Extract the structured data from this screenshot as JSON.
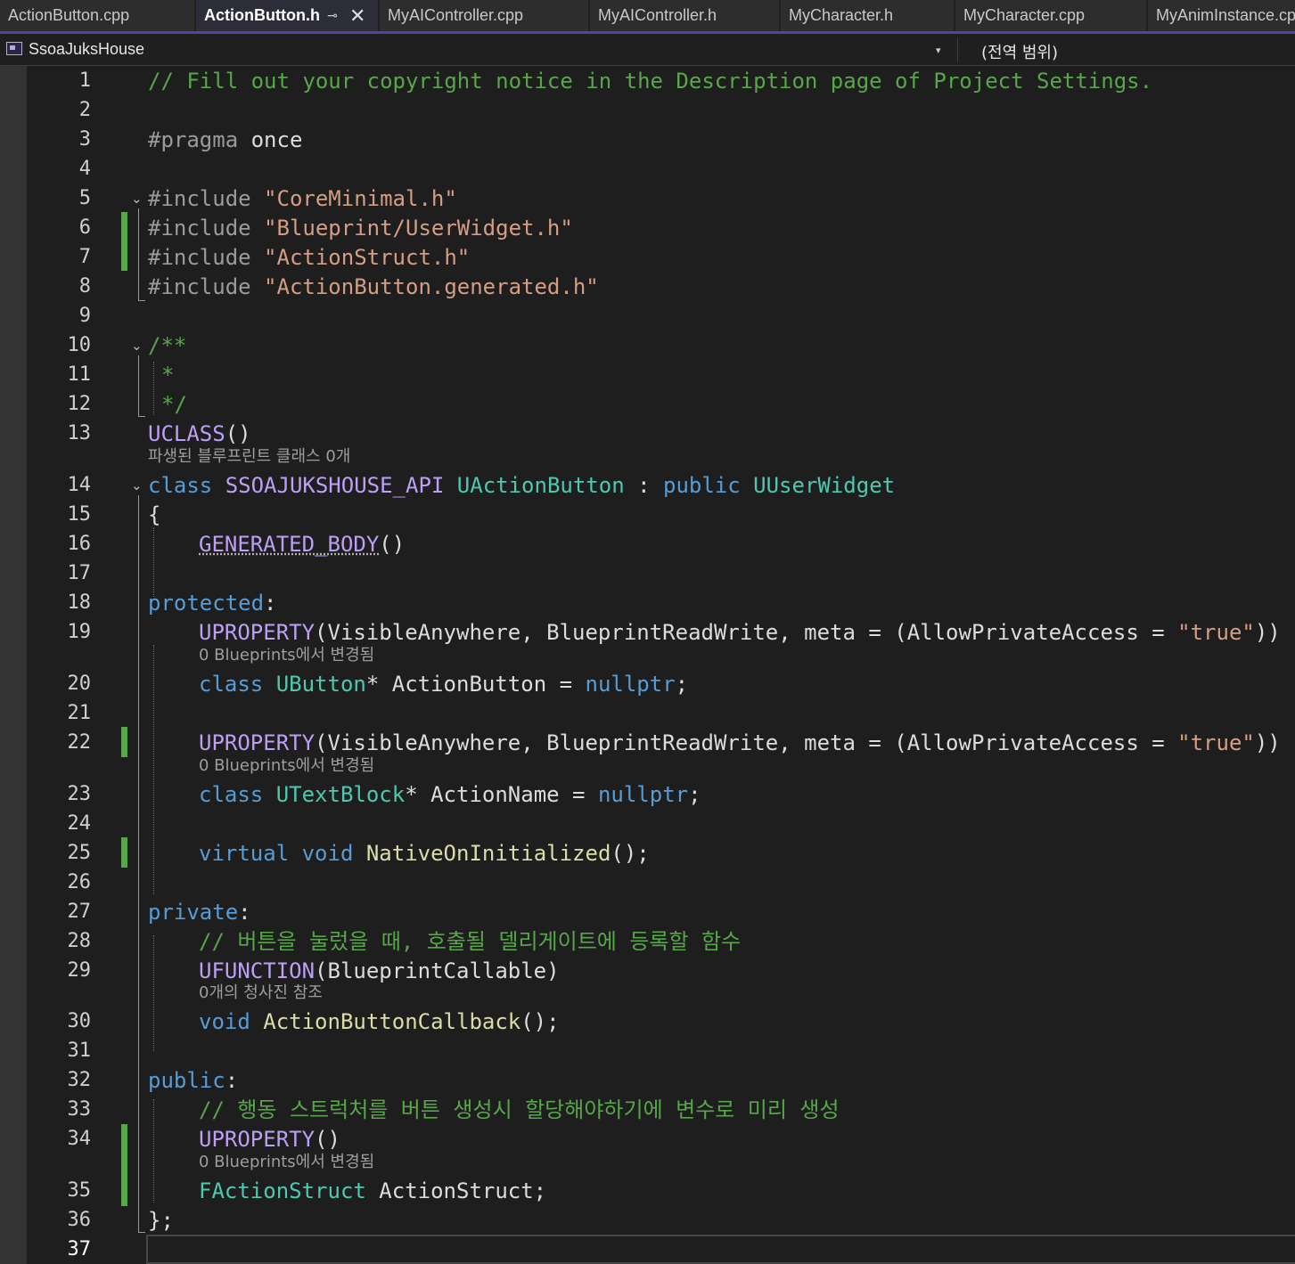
{
  "tabs": [
    {
      "label": "ActionButton.cpp",
      "active": false
    },
    {
      "label": "ActionButton.h",
      "active": true
    },
    {
      "label": "MyAIController.cpp",
      "active": false
    },
    {
      "label": "MyAIController.h",
      "active": false
    },
    {
      "label": "MyCharacter.h",
      "active": false
    },
    {
      "label": "MyCharacter.cpp",
      "active": false
    },
    {
      "label": "MyAnimInstance.cp",
      "active": false
    }
  ],
  "tab_pin_glyph": "⊸",
  "tab_close_glyph": "✕",
  "navbar": {
    "project": "SsoaJuksHouse",
    "dropdown_glyph": "▾",
    "scope": "(전역 범위)"
  },
  "colors": {
    "comment": "#57a64a",
    "preprocessor": "#9b9b9b",
    "string": "#d69d85",
    "keyword": "#569cd6",
    "type": "#4ec9b0",
    "macro": "#bd9ff5",
    "function": "#dcdcaa",
    "plain": "#dcdcdc",
    "change_bar": "#57a64a",
    "accent": "#5b3fa0"
  },
  "line_numbers": [
    "1",
    "2",
    "3",
    "4",
    "5",
    "6",
    "7",
    "8",
    "9",
    "10",
    "11",
    "12",
    "13",
    "14",
    "15",
    "16",
    "17",
    "18",
    "19",
    "20",
    "21",
    "22",
    "23",
    "24",
    "25",
    "26",
    "27",
    "28",
    "29",
    "30",
    "31",
    "32",
    "33",
    "34",
    "35",
    "36",
    "37"
  ],
  "code": {
    "l1": "// Fill out your copyright notice in the Description page of Project Settings.",
    "l3_a": "#pragma",
    "l3_b": " once",
    "include_kw": "#include",
    "l5_str": "\"CoreMinimal.h\"",
    "l6_str": "\"Blueprint/UserWidget.h\"",
    "l7_str": "\"ActionStruct.h\"",
    "l8_str": "\"ActionButton.generated.h\"",
    "l10": "/**",
    "l11": "*",
    "l12": "*/",
    "l13_a": "UCLASS",
    "l13_b": "()",
    "hint_13": "파생된 블루프린트 클래스 0개",
    "l14_class": "class",
    "l14_api": "SSOAJUKSHOUSE_API",
    "l14_name": "UActionButton",
    "l14_colon": " : ",
    "l14_public": "public",
    "l14_base": "UUserWidget",
    "l15": "{",
    "l16_a": "GENERATED_BODY",
    "l16_b": "()",
    "l18_a": "protected",
    "l18_b": ":",
    "uprop": "UPROPERTY",
    "l19_args": "(VisibleAnywhere, BlueprintReadWrite, meta = (AllowPrivateAccess = ",
    "l19_true": "\"true\"",
    "l19_end": "))",
    "hint_19": "0 Blueprints에서 변경됨",
    "kw_class": "class",
    "l20_type": "UButton",
    "l20_rest": "* ActionButton = ",
    "kw_nullptr": "nullptr",
    "semicolon": ";",
    "hint_22": "0 Blueprints에서 변경됨",
    "l23_type": "UTextBlock",
    "l23_rest": "* ActionName = ",
    "l25_virtual": "virtual",
    "l25_void": "void",
    "l25_func": "NativeOnInitialized",
    "l25_end": "();",
    "l27_a": "private",
    "l27_b": ":",
    "l28": "// 버튼을 눌렀을 때, 호출될 델리게이트에 등록할 함수",
    "l29_a": "UFUNCTION",
    "l29_b": "(BlueprintCallable)",
    "hint_29": "0개의 청사진 참조",
    "l30_void": "void",
    "l30_func": "ActionButtonCallback",
    "l30_end": "();",
    "l32_a": "public",
    "l32_b": ":",
    "l33": "// 행동 스트럭처를 버튼 생성시 할당해야하기에 변수로 미리 생성",
    "l34_b": "()",
    "hint_34": "0 Blueprints에서 변경됨",
    "l35_type": "FActionStruct",
    "l35_rest": " ActionStruct;",
    "l36_a": "}",
    "l36_b": ";"
  },
  "fold_glyph": "⌄"
}
